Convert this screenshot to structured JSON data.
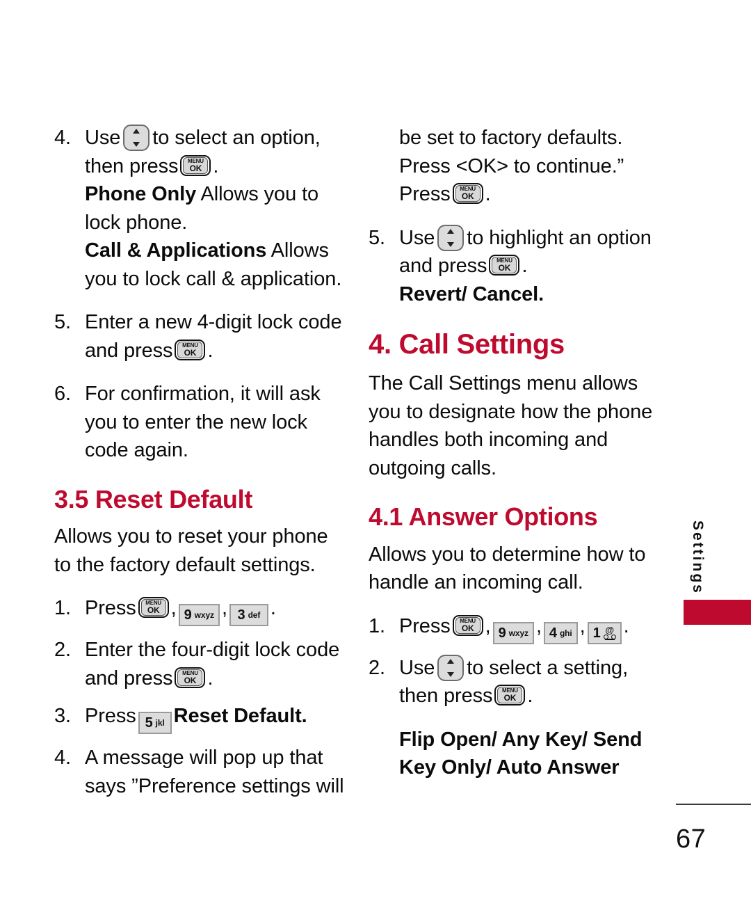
{
  "page": {
    "number": "67",
    "side_tab": "Settings",
    "accent_color": "#BE0A2E"
  },
  "icons": {
    "menu_ok": {
      "top": "MENU",
      "bottom": "OK",
      "name": "menu-ok-key"
    },
    "nav": {
      "name": "navigation-up-down-key"
    },
    "key9": {
      "digit": "9",
      "letters": "wxyz"
    },
    "key3": {
      "digit": "3",
      "letters": "def"
    },
    "key4": {
      "digit": "4",
      "letters": "ghi"
    },
    "key5": {
      "digit": "5",
      "letters": "jkl"
    },
    "key1": {
      "digit": "1",
      "letters": "voicemail"
    }
  },
  "left_column": {
    "step4": {
      "num": "4.",
      "t1": "Use",
      "t2": "to select an option,",
      "t3": "then press",
      "t4": ".",
      "opt1_label": "Phone Only",
      "opt1_desc": " Allows you to lock phone.",
      "opt2_label": "Call & Applications",
      "opt2_desc": " Allows you to lock call & application."
    },
    "step5": {
      "num": "5.",
      "t1": "Enter a new 4-digit lock code and press",
      "t2": "."
    },
    "step6": {
      "num": "6.",
      "t1": "For confirmation, it will ask you to enter the new lock code again."
    },
    "heading": "3.5 Reset Default",
    "intro": "Allows you to reset your phone to the factory default settings.",
    "r_step1": {
      "num": "1.",
      "t1": "Press",
      "c1": ",",
      "c2": ",",
      "t2": "."
    },
    "r_step2": {
      "num": "2.",
      "t1": "Enter the four-digit lock code and press",
      "t2": "."
    },
    "r_step3": {
      "num": "3.",
      "t1": "Press",
      "t2": "Reset Default."
    },
    "r_step4": {
      "num": "4.",
      "t1": "A message will pop up that says ”Preference settings will"
    }
  },
  "right_column": {
    "cont_line1": "be set to factory defaults.",
    "cont_line2": "Press <OK> to continue.”",
    "cont_line3": "Press",
    "cont_line4": ".",
    "step5": {
      "num": "5.",
      "t1": "Use",
      "t2": "to highlight an",
      "t3": "option and press",
      "t4": ".",
      "options": "Revert/ Cancel."
    },
    "heading_main": "4. Call Settings",
    "intro": "The Call Settings menu allows you to designate how the phone handles both incoming and outgoing calls.",
    "heading_sub": "4.1 Answer Options",
    "sub_intro": "Allows you to determine how to handle an incoming call.",
    "a_step1": {
      "num": "1.",
      "t1": "Press",
      "c1": ",",
      "c2": ",",
      "c3": ",",
      "t2": "."
    },
    "a_step2": {
      "num": "2.",
      "t1": "Use",
      "t2": "to select a setting,",
      "t3": "then press",
      "t4": "."
    },
    "options_bold": "Flip Open/ Any Key/ Send Key Only/ Auto Answer"
  }
}
